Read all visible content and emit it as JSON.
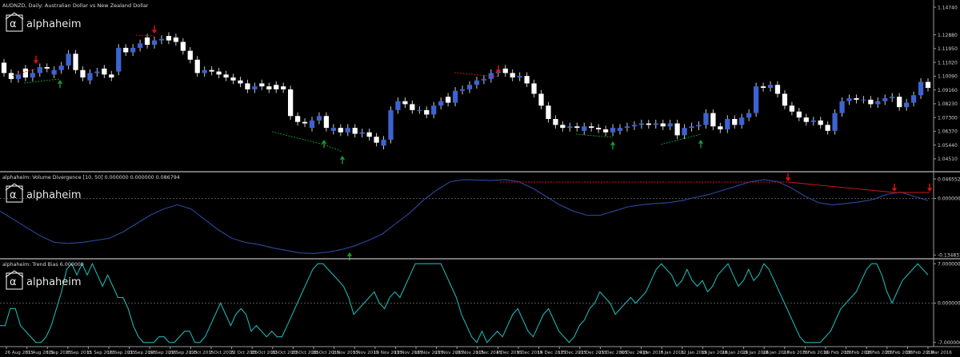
{
  "window": {
    "symbol_caption": "AUDNZD, Daily:  Australian Dollar vs New Zealand Dollar",
    "logo_text": "alphaheim",
    "logo_glyph": "α"
  },
  "colors": {
    "background": "#000000",
    "bull_candle": "#3d63d0",
    "bear_candle": "#ffffff",
    "wick": "#c8c8c8",
    "sell_arrow": "#e01010",
    "buy_arrow": "#10a030",
    "divergence_bear": "#d01818",
    "divergence_bull": "#10a030",
    "volume_line": "#2a4a9e",
    "trend_line": "#1fb3b3",
    "zero_line": "#6a6a6a",
    "separator": "#9a9a9a"
  },
  "chart_data": [
    {
      "type": "candlestick",
      "title": "",
      "ylim": [
        1.0375,
        1.1512
      ],
      "y_tick_labels": [
        "1.14740",
        "1.12880",
        "1.11950",
        "1.11020",
        "1.10090",
        "1.09160",
        "1.08230",
        "1.07300",
        "1.06370",
        "1.05440",
        "1.04510"
      ],
      "x_tick_labels": [
        "26 Aug 2015",
        "31 Aug 2015",
        "3 Sep 2015",
        "8 Sep 2015",
        "11 Sep 2015",
        "16 Sep 2015",
        "21 Sep 2015",
        "24 Sep 2015",
        "29 Sep 2015",
        "2 Oct 2015",
        "7 Oct 2015",
        "12 Oct 2015",
        "15 Oct 2015",
        "20 Oct 2015",
        "23 Oct 2015",
        "28 Oct 2015",
        "2 Nov 2015",
        "5 Nov 2015",
        "10 Nov 2015",
        "13 Nov 2015",
        "18 Nov 2015",
        "23 Nov 2015",
        "26 Nov 2015",
        "1 Dec 2015",
        "4 Dec 2015",
        "9 Dec 2015",
        "14 Dec 2015",
        "17 Dec 2015",
        "22 Dec 2015",
        "25 Dec 2015",
        "30 Dec 2015",
        "4 Jan 2016",
        "7 Jan 2016",
        "12 Jan 2016",
        "15 Jan 2016",
        "20 Jan 2016",
        "25 Jan 2016",
        "28 Jan 2016",
        "2 Feb 2016",
        "5 Feb 2016",
        "10 Feb 2016",
        "15 Feb 2016",
        "18 Feb 2016",
        "23 Feb 2016",
        "26 Feb 2016",
        "2 Mar 2016"
      ],
      "close": [
        1.103,
        1.099,
        1.102,
        1.1,
        1.103,
        1.107,
        1.106,
        1.105,
        1.108,
        1.116,
        1.105,
        1.1,
        1.103,
        1.104,
        1.102,
        1.1,
        1.12,
        1.117,
        1.12,
        1.123,
        1.122,
        1.125,
        1.126,
        1.125,
        1.124,
        1.118,
        1.112,
        1.103,
        1.105,
        1.104,
        1.102,
        1.1,
        1.098,
        1.096,
        1.092,
        1.094,
        1.094,
        1.092,
        1.092,
        1.092,
        1.074,
        1.07,
        1.069,
        1.071,
        1.074,
        1.066,
        1.066,
        1.063,
        1.066,
        1.062,
        1.063,
        1.06,
        1.056,
        1.058,
        1.078,
        1.084,
        1.082,
        1.078,
        1.078,
        1.075,
        1.081,
        1.084,
        1.083,
        1.091,
        1.092,
        1.095,
        1.098,
        1.099,
        1.103,
        1.104,
        1.103,
        1.1,
        1.101,
        1.096,
        1.089,
        1.081,
        1.072,
        1.068,
        1.066,
        1.067,
        1.066,
        1.067,
        1.066,
        1.065,
        1.063,
        1.066,
        1.066,
        1.067,
        1.068,
        1.069,
        1.068,
        1.069,
        1.067,
        1.069,
        1.061,
        1.066,
        1.067,
        1.068,
        1.076,
        1.067,
        1.065,
        1.072,
        1.068,
        1.073,
        1.076,
        1.094,
        1.093,
        1.095,
        1.089,
        1.081,
        1.077,
        1.073,
        1.07,
        1.071,
        1.068,
        1.064,
        1.076,
        1.084,
        1.086,
        1.085,
        1.085,
        1.082,
        1.084,
        1.086,
        1.087,
        1.08,
        1.083,
        1.088,
        1.097,
        1.093
      ],
      "candle_direction_note": "",
      "open": [
        1.11,
        1.103,
        1.099,
        1.106,
        1.1,
        1.103,
        1.107,
        1.102,
        1.105,
        1.108,
        1.116,
        1.105,
        1.098,
        1.103,
        1.106,
        1.102,
        1.104,
        1.12,
        1.117,
        1.12,
        1.127,
        1.122,
        1.125,
        1.128,
        1.127,
        1.124,
        1.118,
        1.112,
        1.103,
        1.105,
        1.104,
        1.102,
        1.1,
        1.098,
        1.096,
        1.092,
        1.096,
        1.094,
        1.095,
        1.094,
        1.092,
        1.074,
        1.07,
        1.066,
        1.071,
        1.074,
        1.064,
        1.066,
        1.063,
        1.066,
        1.062,
        1.063,
        1.06,
        1.054,
        1.058,
        1.078,
        1.084,
        1.082,
        1.078,
        1.078,
        1.075,
        1.081,
        1.087,
        1.083,
        1.091,
        1.092,
        1.095,
        1.098,
        1.099,
        1.103,
        1.106,
        1.103,
        1.1,
        1.101,
        1.096,
        1.089,
        1.081,
        1.072,
        1.068,
        1.066,
        1.067,
        1.064,
        1.067,
        1.066,
        1.065,
        1.063,
        1.064,
        1.066,
        1.067,
        1.068,
        1.069,
        1.068,
        1.069,
        1.067,
        1.069,
        1.061,
        1.066,
        1.067,
        1.068,
        1.076,
        1.067,
        1.065,
        1.072,
        1.068,
        1.073,
        1.076,
        1.094,
        1.093,
        1.095,
        1.089,
        1.081,
        1.077,
        1.073,
        1.07,
        1.071,
        1.068,
        1.064,
        1.076,
        1.084,
        1.086,
        1.085,
        1.085,
        1.082,
        1.084,
        1.086,
        1.087,
        1.08,
        1.083,
        1.088,
        1.097
      ]
    },
    {
      "type": "line",
      "title": "alphaheim: Volume Divergence [10, 50] 0.000000 0.000000 0.086794",
      "ylim": [
        -0.14,
        0.06
      ],
      "y_tick_labels": [
        "0.046552",
        "0.000000",
        "-0.134833"
      ],
      "zero_line": 0.0,
      "values": [
        -0.03,
        -0.05,
        -0.07,
        -0.09,
        -0.105,
        -0.107,
        -0.105,
        -0.1,
        -0.095,
        -0.08,
        -0.06,
        -0.04,
        -0.025,
        -0.015,
        -0.025,
        -0.05,
        -0.075,
        -0.095,
        -0.105,
        -0.11,
        -0.118,
        -0.124,
        -0.13,
        -0.131,
        -0.128,
        -0.122,
        -0.113,
        -0.1,
        -0.085,
        -0.06,
        -0.035,
        -0.005,
        0.02,
        0.04,
        0.045,
        0.044,
        0.043,
        0.045,
        0.04,
        0.025,
        0.005,
        -0.015,
        -0.03,
        -0.04,
        -0.04,
        -0.03,
        -0.02,
        -0.015,
        -0.012,
        -0.01,
        -0.005,
        0.003,
        0.01,
        0.02,
        0.03,
        0.04,
        0.045,
        0.04,
        0.025,
        0.005,
        -0.01,
        -0.015,
        -0.012,
        -0.008,
        -0.002,
        0.01,
        0.015,
        0.005,
        -0.005
      ]
    },
    {
      "type": "line",
      "title": "alphaheim: Trend Bias 6.000000",
      "ylim": [
        -7.6,
        7.6
      ],
      "y_tick_labels": [
        "7.000000",
        "0.000000",
        "-7.000000"
      ],
      "zero_line": 0.0,
      "values": [
        -4,
        -4,
        -1,
        -1,
        -4,
        -5,
        -6,
        -7,
        -7,
        -6,
        -4,
        -1,
        2,
        6,
        7,
        5,
        7,
        5,
        7,
        5,
        3,
        5,
        3,
        1,
        1,
        -1,
        -4,
        -6,
        -7,
        -7,
        -7,
        -6,
        -6,
        -7,
        -7,
        -6,
        -5,
        -5,
        -7,
        -7,
        -6,
        -4,
        -2,
        0,
        -2,
        -4,
        -2,
        -1,
        -2,
        -5,
        -4,
        -5,
        -6,
        -5,
        -6,
        -6,
        -4,
        -2,
        0,
        2,
        4,
        6,
        7,
        7,
        6,
        5,
        4,
        3,
        1,
        -2,
        -1,
        0,
        1,
        2,
        0,
        -1,
        1,
        2,
        1,
        3,
        5,
        7,
        7,
        7,
        7,
        7,
        7,
        5,
        3,
        1,
        -2,
        -4,
        -6,
        -7,
        -5,
        -7,
        -6,
        -5,
        -6,
        -4,
        -2,
        -1,
        -3,
        -5,
        -6,
        -4,
        -2,
        -1,
        -3,
        -5,
        -6,
        -7,
        -6,
        -4,
        -3,
        -1,
        0,
        2,
        1,
        0,
        -2,
        -1,
        0,
        1,
        0,
        1,
        2,
        4,
        6,
        7,
        6,
        5,
        3,
        4,
        6,
        4,
        3,
        4,
        2,
        3,
        5,
        6,
        7,
        5,
        3,
        4,
        6,
        4,
        5,
        7,
        6,
        4,
        2,
        0,
        -2,
        -4,
        -6,
        -7,
        -7,
        -7,
        -7,
        -6,
        -5,
        -3,
        -1,
        0,
        1,
        2,
        4,
        6,
        7,
        7,
        5,
        2,
        0,
        2,
        4,
        5,
        6,
        7,
        6,
        5
      ]
    }
  ]
}
